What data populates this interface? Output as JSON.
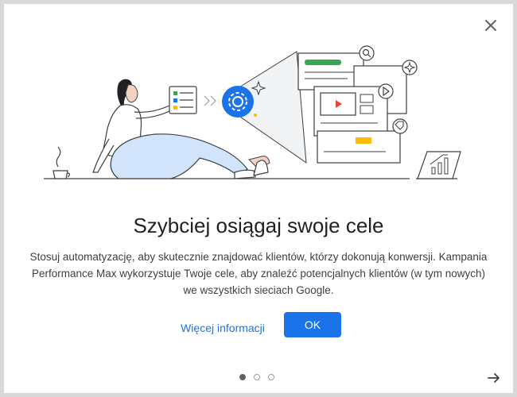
{
  "dialog": {
    "title": "Szybciej osiągaj swoje cele",
    "body": "Stosuj automatyzację, aby skutecznie znajdować klientów, którzy dokonują konwersji. Kampania Performance Max wykorzystuje Twoje cele, aby znaleźć potencjalnych klientów (w tym nowych) we wszystkich sieciach Google.",
    "learn_more_label": "Więcej informacji",
    "ok_label": "OK"
  },
  "pagination": {
    "total_pages": 3,
    "current_page": 1
  },
  "icons": {
    "close": "close-icon",
    "next": "arrow-right-icon"
  },
  "colors": {
    "primary": "#1a73e8",
    "green": "#34a853",
    "red": "#ea4335",
    "yellow": "#fbbc04",
    "text": "#202124"
  }
}
